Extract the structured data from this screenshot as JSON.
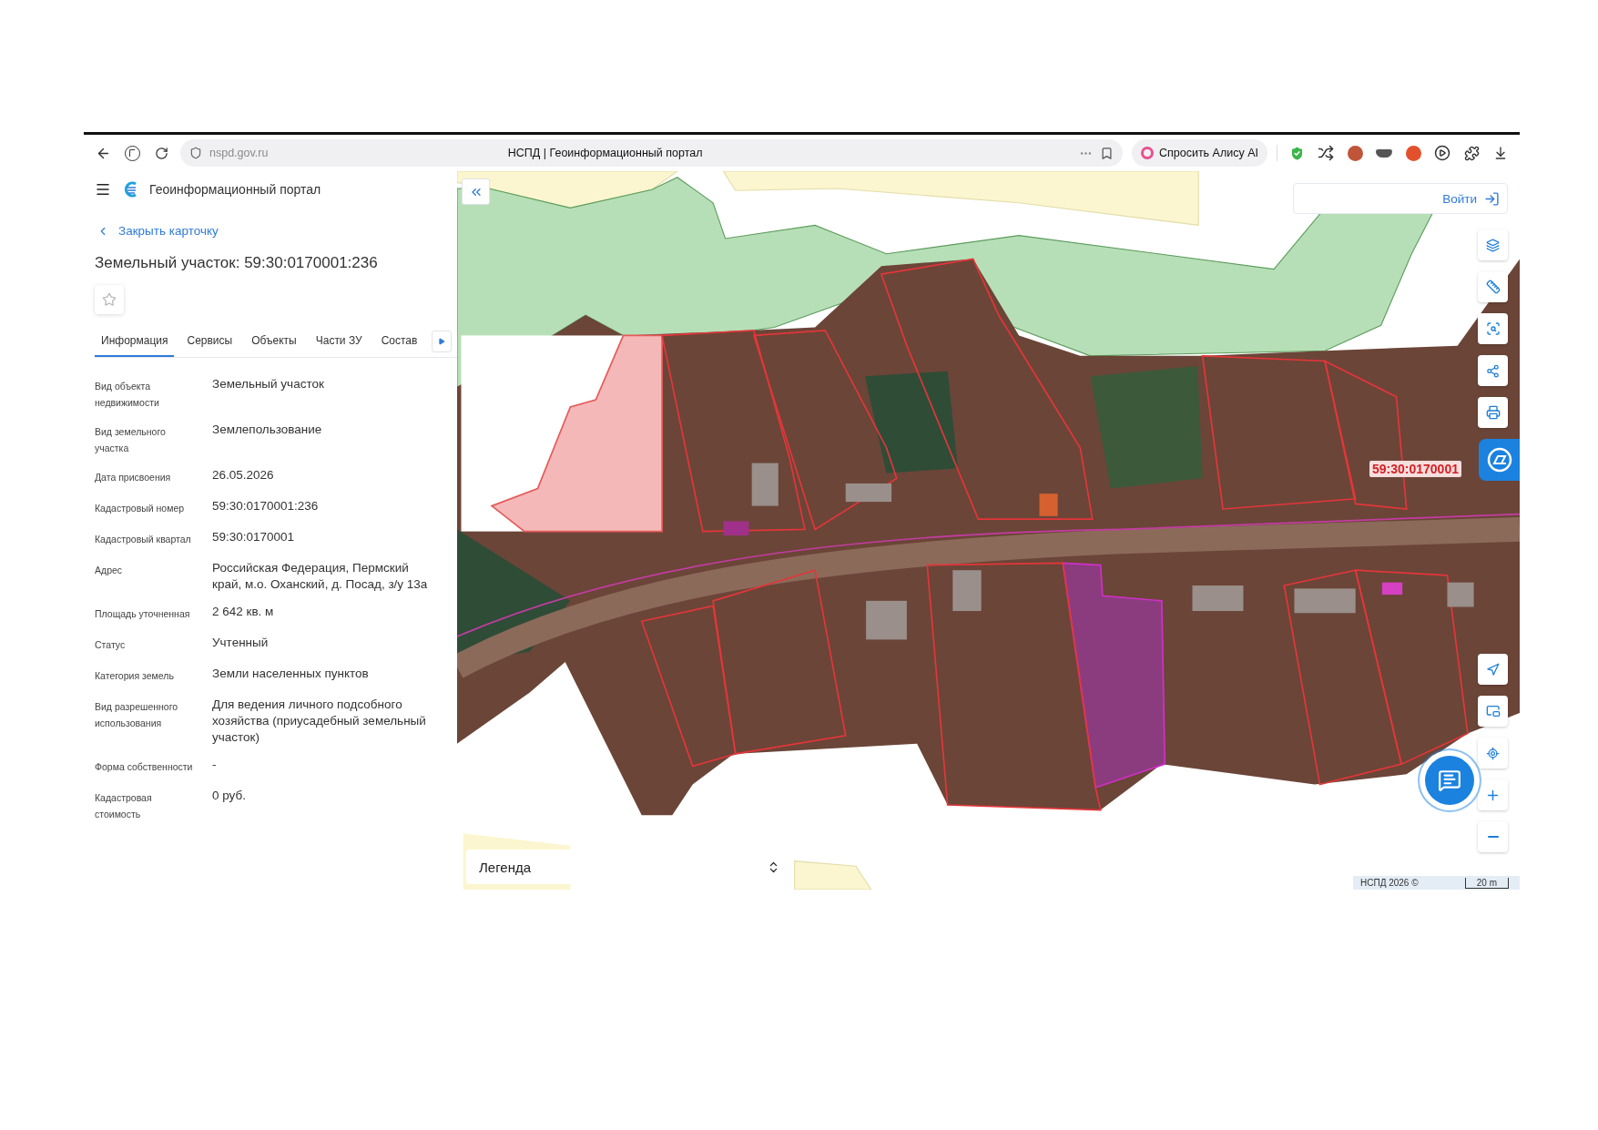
{
  "browser": {
    "url": "nspd.gov.ru",
    "tab_title": "НСПД | Геоинформационный портал",
    "alice_button": "Спросить Алису AI"
  },
  "header": {
    "title": "Геоинформационный портал"
  },
  "card": {
    "close_link": "Закрыть карточку",
    "title": "Земельный участок: 59:30:0170001:236",
    "favorite": false,
    "tabs": [
      {
        "label": "Информация",
        "selected": true
      },
      {
        "label": "Сервисы",
        "selected": false
      },
      {
        "label": "Объекты",
        "selected": false
      },
      {
        "label": "Части ЗУ",
        "selected": false
      },
      {
        "label": "Состав",
        "selected": false
      }
    ],
    "fields": [
      {
        "label": "Вид объекта недвижимости",
        "value": "Земельный участок"
      },
      {
        "label": "Вид земельного участка",
        "value": "Землепользование"
      },
      {
        "label": "Дата присвоения",
        "value": "26.05.2026"
      },
      {
        "label": "Кадастровый номер",
        "value": "59:30:0170001:236"
      },
      {
        "label": "Кадастровый квартал",
        "value": "59:30:0170001"
      },
      {
        "label": "Адрес",
        "value": "Российская Федерация, Пермский край, м.о. Оханский, д. Посад, з/у 13а"
      },
      {
        "label": "Площадь уточненная",
        "value": "2 642 кв. м"
      },
      {
        "label": "Статус",
        "value": "Учтенный"
      },
      {
        "label": "Категория земель",
        "value": "Земли населенных пунктов"
      },
      {
        "label": "Вид разрешенного использования",
        "value": "Для ведения личного подсобного хозяйства (приусадебный земельный участок)"
      },
      {
        "label": "Форма собственности",
        "value": "-"
      },
      {
        "label": "Кадастровая стоимость",
        "value": "0 руб."
      }
    ]
  },
  "map": {
    "login_button": "Войти",
    "parcel_label": "59:30:0170001",
    "legend": "Легенда",
    "copyright": "НСПД 2026 ©",
    "scale": "20 m"
  }
}
